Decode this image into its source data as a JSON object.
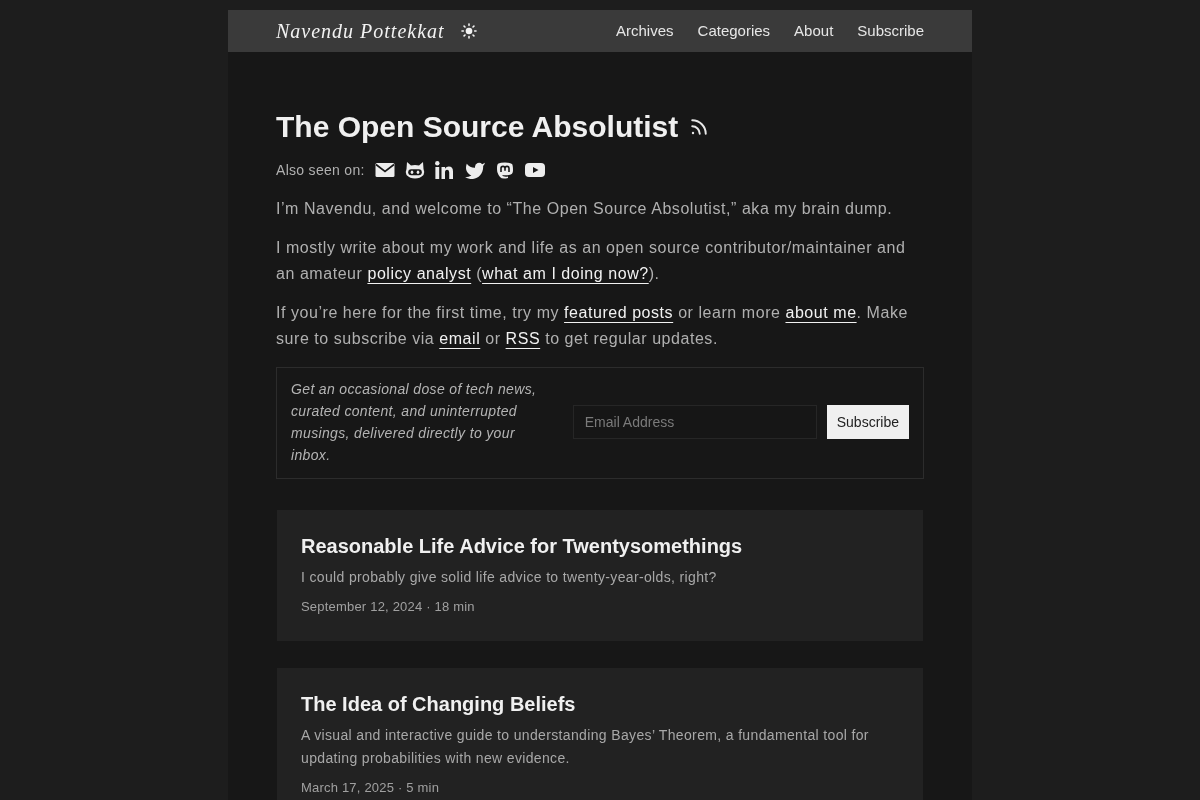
{
  "header": {
    "logo": "Navendu Pottekkat",
    "nav": [
      "Archives",
      "Categories",
      "About",
      "Subscribe"
    ]
  },
  "intro": {
    "title": "The Open Source Absolutist",
    "also_seen_on": "Also seen on:"
  },
  "paragraphs": [
    [
      {
        "kind": "text",
        "text": "I’m Navendu, and welcome to “The Open Source Absolutist,” aka my brain dump."
      }
    ],
    [
      {
        "kind": "text",
        "text": "I mostly write about my work and life as an open source contributor/maintainer and an amateur "
      },
      {
        "kind": "link",
        "text": "policy analyst"
      },
      {
        "kind": "text",
        "text": " ("
      },
      {
        "kind": "link",
        "text": "what am I doing now?"
      },
      {
        "kind": "text",
        "text": ")."
      }
    ],
    [
      {
        "kind": "text",
        "text": "If you’re here for the first time, try my "
      },
      {
        "kind": "link",
        "text": "featured posts"
      },
      {
        "kind": "text",
        "text": " or learn more "
      },
      {
        "kind": "link",
        "text": "about me"
      },
      {
        "kind": "text",
        "text": ". Make sure to subscribe via "
      },
      {
        "kind": "link",
        "text": "email"
      },
      {
        "kind": "text",
        "text": " or "
      },
      {
        "kind": "link",
        "text": "RSS"
      },
      {
        "kind": "text",
        "text": " to get regular updates."
      }
    ]
  ],
  "newsletter": {
    "text": "Get an occasional dose of tech news, curated content, and uninterrupted musings, delivered directly to your inbox.",
    "placeholder": "Email Address",
    "button": "Subscribe"
  },
  "posts": [
    {
      "title": "Reasonable Life Advice for Twentysomethings",
      "description": "I could probably give solid life advice to twenty-year-olds, right?",
      "meta": "September 12, 2024 · 18 min"
    },
    {
      "title": "The Idea of Changing Beliefs",
      "description": "A visual and interactive guide to understanding Bayes’ Theorem, a fundamental tool for updating probabilities with new evidence.",
      "meta": "March 17, 2025 · 5 min"
    }
  ]
}
